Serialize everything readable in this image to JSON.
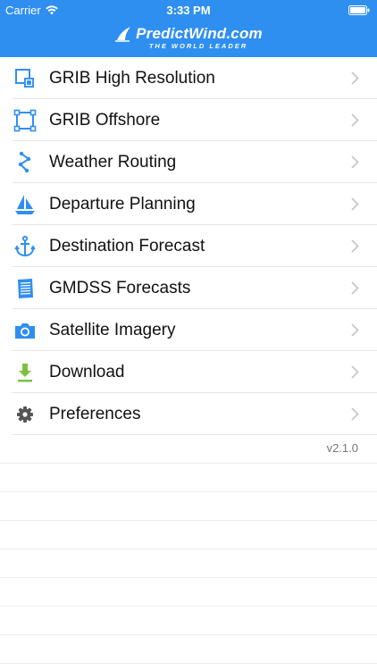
{
  "status_bar": {
    "carrier": "Carrier",
    "time": "3:33 PM"
  },
  "header": {
    "logo_text": "PredictWind.com",
    "logo_tagline": "THE WORLD LEADER",
    "background_color": "#2f8ff0"
  },
  "menu": {
    "items": [
      {
        "label": "GRIB High Resolution",
        "icon": "grib-high-resolution-icon"
      },
      {
        "label": "GRIB Offshore",
        "icon": "grib-offshore-icon"
      },
      {
        "label": "Weather Routing",
        "icon": "weather-routing-icon"
      },
      {
        "label": "Departure Planning",
        "icon": "sailboat-icon"
      },
      {
        "label": "Destination Forecast",
        "icon": "anchor-icon"
      },
      {
        "label": "GMDSS Forecasts",
        "icon": "document-icon"
      },
      {
        "label": "Satellite Imagery",
        "icon": "camera-icon"
      },
      {
        "label": "Download",
        "icon": "download-icon"
      },
      {
        "label": "Preferences",
        "icon": "gear-icon"
      }
    ]
  },
  "footer": {
    "version": "v2.1.0"
  },
  "colors": {
    "icon_blue": "#2f8ff0",
    "download_green": "#7cc242",
    "gear_gray": "#555555",
    "chevron": "#c7c7cc"
  }
}
